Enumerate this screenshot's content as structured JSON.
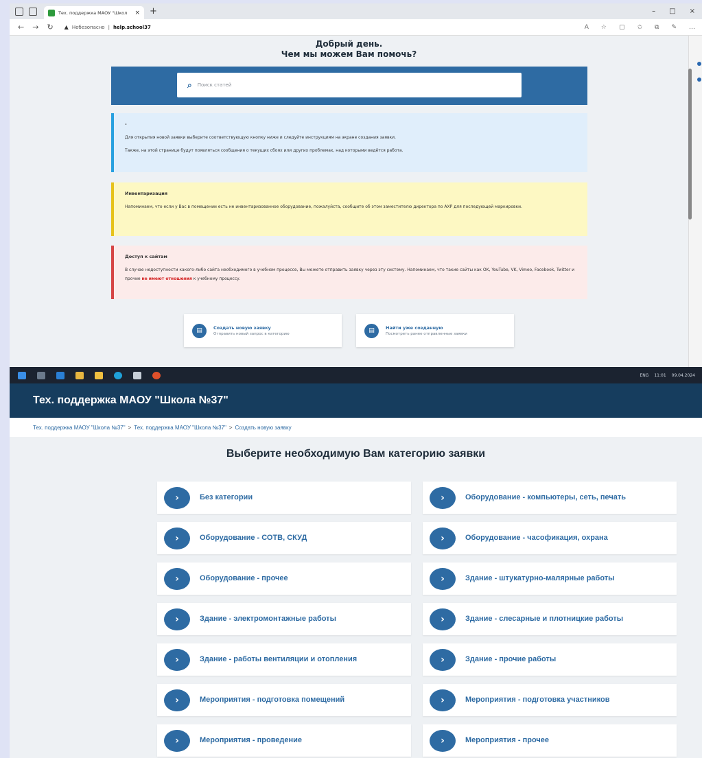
{
  "browser": {
    "tab_title": "Тех. поддержка МАОУ \"Школ",
    "security_label": "Небезопасно",
    "url": "help.school37",
    "window_controls": [
      "–",
      "□",
      "×"
    ]
  },
  "help_page": {
    "greeting_line1": "Добрый день.",
    "greeting_line2": "Чем мы можем Вам помочь?",
    "search_placeholder": "Поиск статей",
    "notices": [
      {
        "title": "-",
        "lines": [
          "Для открытия новой заявки выберите соответствующую кнопку ниже и следуйте инструкциям на экране создания заявки.",
          "Также, на этой странице будут появляться сообщения о текущих сбоях или других проблемах, над которыми ведётся работа."
        ]
      },
      {
        "title": "Инвентаризация",
        "lines": [
          "Напоминаем, что если у Вас в помещении есть не инвентаризованное оборудование, пожалуйста, сообщите об этом заместителю директора по АХР для последующей маркировки."
        ]
      },
      {
        "title": "Доступ к сайтам",
        "line_before": "В случае недоступности какого-либо сайта необходимого в учебном процессе, Вы можете отправить заявку через эту систему. Напоминаем, что такие сайты как OK, YouTube, VK, Vimeo, Facebook, Twitter и прочие ",
        "highlight": "не имеют отношения",
        "line_after": " к учебному процессу."
      }
    ],
    "actions": [
      {
        "title": "Создать новую заявку",
        "subtitle": "Отправить новый запрос в категорию"
      },
      {
        "title": "Найти уже созданную",
        "subtitle": "Посмотреть ранее отправленные заявки"
      }
    ]
  },
  "taskbar": {
    "tray_lang": "ENG",
    "tray_time": "11:01",
    "tray_date": "09.04.2024"
  },
  "category_page": {
    "header_title": "Тех. поддержка МАОУ \"Школа №37\"",
    "breadcrumbs": [
      "Тех. поддержка МАОУ \"Школа №37\"",
      "Тех. поддержка МАОУ \"Школа №37\"",
      "Создать новую заявку"
    ],
    "breadcrumb_sep": ">",
    "page_title": "Выберите необходимую Вам категорию заявки",
    "categories": [
      "Без категории",
      "Оборудование - компьютеры, сеть, печать",
      "Оборудование - СОТВ, СКУД",
      "Оборудование - часофикация, охрана",
      "Оборудование - прочее",
      "Здание - штукатурно-малярные работы",
      "Здание - электромонтажные работы",
      "Здание - слесарные и плотницкие работы",
      "Здание - работы вентиляции и отопления",
      "Здание - прочие работы",
      "Мероприятия - подготовка помещений",
      "Мероприятия - подготовка участников",
      "Мероприятия - проведение",
      "Мероприятия - прочее"
    ]
  },
  "colors": {
    "brand_blue": "#2e6ba3",
    "header_navy": "#163d5e",
    "info_blue": "#27a0e0",
    "warning_yellow": "#e6c21a",
    "danger_red": "#d64545"
  }
}
